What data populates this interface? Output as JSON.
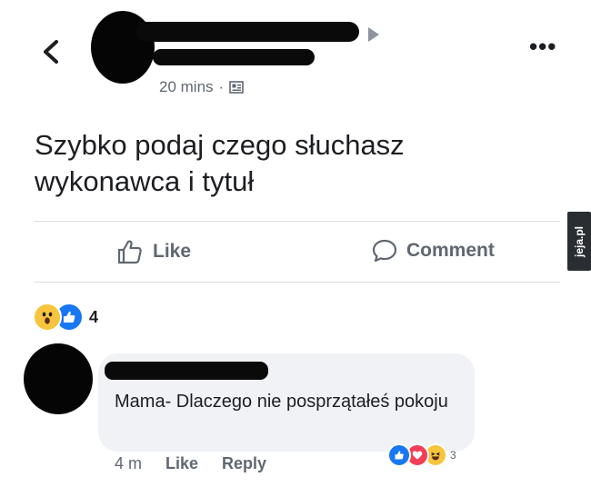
{
  "header": {
    "time": "20 mins",
    "dot": "·",
    "audience_icon": "contact-card-icon",
    "back_icon": "chevron-left-icon",
    "more_icon": "more-horizontal-icon",
    "more_label": "•••"
  },
  "post": {
    "text": "Szybko podaj czego słuchasz wykonawca i tytuł"
  },
  "actions": {
    "like_label": "Like",
    "comment_label": "Comment"
  },
  "reactions": {
    "count": "4",
    "types": [
      "wow",
      "like"
    ]
  },
  "comment": {
    "text": "Mama- Dlaczego nie posprzątałeś pokoju",
    "time": "4 m",
    "like_label": "Like",
    "reply_label": "Reply",
    "reaction_count": "3",
    "reaction_types": [
      "like",
      "love",
      "haha"
    ]
  },
  "watermark": "jeja.pl",
  "colors": {
    "link_blue": "#1877f2",
    "secondary_text": "#606770",
    "bubble_bg": "#f0f2f5",
    "wow_yellow": "#f7c43d",
    "love_red": "#f33e58"
  }
}
